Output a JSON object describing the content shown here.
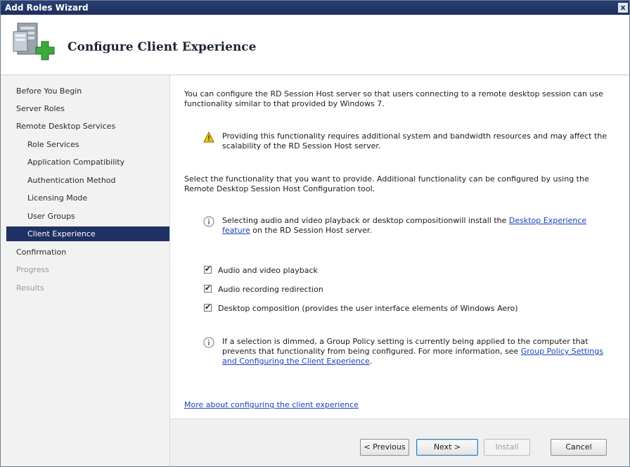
{
  "window": {
    "title": "Add Roles Wizard",
    "close_glyph": "x"
  },
  "header": {
    "heading": "Configure Client Experience",
    "icon": "server-add-role-icon"
  },
  "sidebar": {
    "items": [
      {
        "label": "Before You Begin",
        "state": "normal"
      },
      {
        "label": "Server Roles",
        "state": "normal"
      },
      {
        "label": "Remote Desktop Services",
        "state": "normal"
      },
      {
        "label": "Role Services",
        "state": "sub"
      },
      {
        "label": "Application Compatibility",
        "state": "sub"
      },
      {
        "label": "Authentication Method",
        "state": "sub"
      },
      {
        "label": "Licensing Mode",
        "state": "sub"
      },
      {
        "label": "User Groups",
        "state": "sub"
      },
      {
        "label": "Client Experience",
        "state": "selected"
      },
      {
        "label": "Confirmation",
        "state": "normal"
      },
      {
        "label": "Progress",
        "state": "disabled"
      },
      {
        "label": "Results",
        "state": "disabled"
      }
    ]
  },
  "content": {
    "intro": "You can configure the RD Session Host server so that users connecting to a remote desktop session can use functionality similar to that provided by Windows 7.",
    "warning": "Providing this functionality requires additional system and bandwidth resources and may affect the scalability of the RD Session Host server.",
    "select_text": "Select the functionality that you want to provide. Additional functionality can be configured by using the Remote Desktop Session Host Configuration tool.",
    "info1_pre": "Selecting audio and video playback or desktop compositionwill install the ",
    "info1_link": "Desktop Experience feature",
    "info1_post": " on the RD Session Host server.",
    "checks": [
      {
        "label": "Audio and video playback",
        "checked": true
      },
      {
        "label": "Audio recording redirection",
        "checked": true
      },
      {
        "label": "Desktop composition (provides the user interface elements of Windows Aero)",
        "checked": true
      }
    ],
    "info2_pre": "If a selection is dimmed, a Group Policy setting is currently being applied to the computer that prevents that functionality from being configured. For more information, see ",
    "info2_link": "Group Policy Settings and Configuring the Client Experience",
    "info2_post": ".",
    "more_link": "More about configuring the client experience"
  },
  "buttons": {
    "previous": "< Previous",
    "next": "Next >",
    "install": "Install",
    "cancel": "Cancel"
  },
  "colors": {
    "titlebar": "#1d2f60",
    "selected_nav": "#1f3164",
    "link": "#1a44b8"
  }
}
